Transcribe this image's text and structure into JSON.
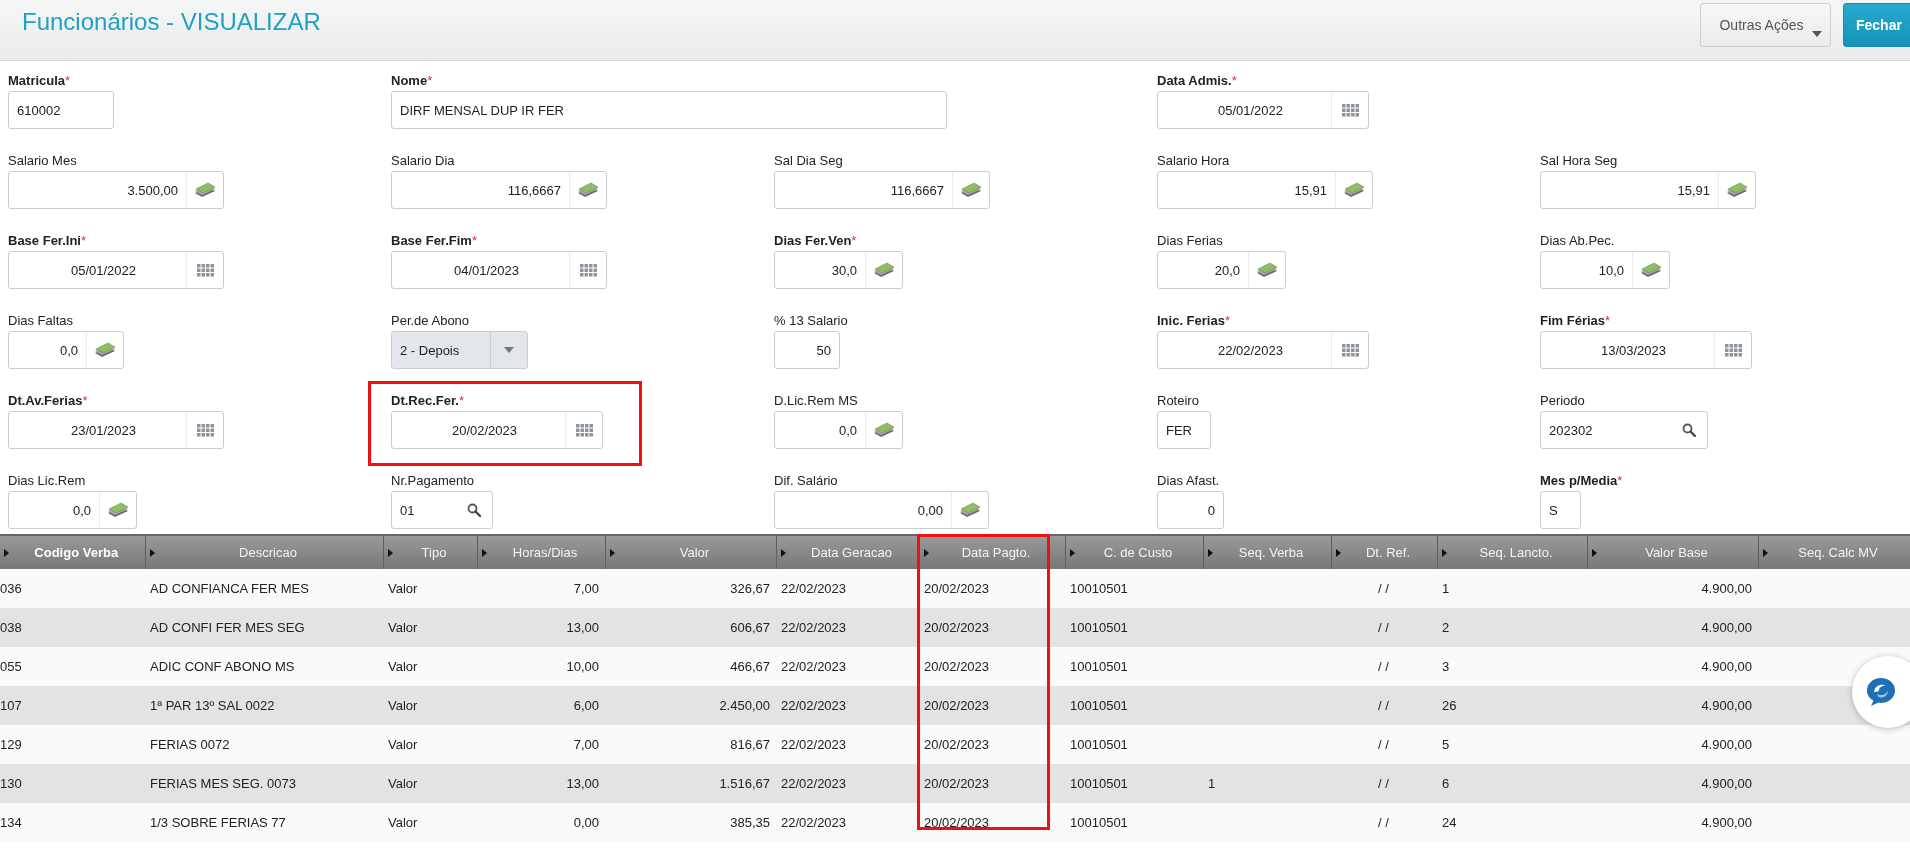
{
  "header": {
    "title": "Funcionários - VISUALIZAR",
    "buttons": [
      {
        "label": "Outras Ações",
        "kind": "menu"
      },
      {
        "label": "Fechar",
        "kind": "primary"
      }
    ]
  },
  "form": {
    "rows": [
      [
        {
          "label": "Matricula",
          "required_mark": "*",
          "kind": "text",
          "value": "610002",
          "highlighted": false
        },
        {
          "label": "Nome",
          "required_mark": "*",
          "kind": "text",
          "value": "DIRF MENSAL DUP IR FER",
          "highlighted": false
        },
        "",
        {
          "label": "Data Admis.",
          "required_mark": "*",
          "kind": "date",
          "value": "05/01/2022",
          "highlighted": false
        }
      ],
      [
        {
          "label": "Salario Mes",
          "kind": "money",
          "value": "3.500,00",
          "highlighted": false
        },
        {
          "label": "Salario Dia",
          "kind": "money",
          "value": "116,6667",
          "highlighted": false
        },
        {
          "label": "Sal Dia Seg",
          "kind": "money",
          "value": "116,6667",
          "highlighted": false
        },
        {
          "label": "Salario Hora",
          "kind": "money",
          "value": "15,91",
          "highlighted": false
        },
        {
          "label": "Sal Hora Seg",
          "kind": "money",
          "value": "15,91",
          "highlighted": false
        }
      ],
      [
        {
          "label": "Base Fer.Ini",
          "required_mark": "*",
          "kind": "date",
          "value": "05/01/2022",
          "highlighted": false
        },
        {
          "label": "Base Fer.Fim",
          "required_mark": "*",
          "kind": "date",
          "value": "04/01/2023",
          "highlighted": false
        },
        {
          "label": "Dias Fer.Ven",
          "required_mark": "*",
          "kind": "money",
          "value": "30,0",
          "highlighted": false
        },
        {
          "label": "Dias Ferias",
          "kind": "money",
          "value": "20,0",
          "highlighted": false
        },
        {
          "label": "Dias Ab.Pec.",
          "kind": "money",
          "value": "10,0",
          "highlighted": false
        }
      ],
      [
        {
          "label": "Dias Faltas",
          "kind": "money",
          "value": "0,0",
          "highlighted": false
        },
        {
          "label": "Per.de Abono",
          "kind": "select",
          "value": "2 - Depois",
          "highlighted": false
        },
        {
          "label": "% 13 Salario",
          "kind": "number",
          "value": "50",
          "highlighted": false
        },
        {
          "label": "Inic. Ferias",
          "required_mark": "*",
          "kind": "date",
          "value": "22/02/2023",
          "highlighted": false
        },
        {
          "label": "Fim Férias",
          "required_mark": "*",
          "kind": "date",
          "value": "13/03/2023",
          "highlighted": false
        }
      ],
      [
        {
          "label": "Dt.Av.Ferias",
          "required_mark": "*",
          "kind": "date",
          "value": "23/01/2023",
          "highlighted": false
        },
        {
          "label": "Dt.Rec.Fer.",
          "required_mark": "*",
          "kind": "date",
          "value": "20/02/2023",
          "highlighted": true
        },
        {
          "label": "D.Lic.Rem MS",
          "kind": "money",
          "value": "0,0",
          "highlighted": false
        },
        {
          "label": "Roteiro",
          "kind": "text",
          "value": "FER",
          "highlighted": false
        },
        {
          "label": "Periodo",
          "kind": "search",
          "value": "202302",
          "highlighted": false
        }
      ],
      [
        {
          "label": "Dias Lic.Rem",
          "kind": "money",
          "value": "0,0",
          "highlighted": false
        },
        {
          "label": "Nr.Pagamento",
          "kind": "search",
          "value": "01",
          "highlighted": false
        },
        {
          "label": "Dif. Salário",
          "kind": "money",
          "value": "0,00",
          "highlighted": false
        },
        {
          "label": "Dias Afast.",
          "kind": "number",
          "value": "0",
          "highlighted": false
        },
        {
          "label": "Mes p/Media",
          "required_mark": "*",
          "kind": "text",
          "value": "S",
          "highlighted": false
        }
      ]
    ]
  },
  "table": {
    "columns": [
      {
        "label": "Codigo Verba",
        "active": true,
        "highlighted": false
      },
      {
        "label": "Descricao",
        "active": false,
        "highlighted": false
      },
      {
        "label": "Tipo",
        "active": false,
        "highlighted": false
      },
      {
        "label": "Horas/Dias",
        "active": false,
        "highlighted": false
      },
      {
        "label": "Valor",
        "active": false,
        "highlighted": false
      },
      {
        "label": "Data Geracao",
        "active": false,
        "highlighted": false
      },
      {
        "label": "Data Pagto.",
        "active": false,
        "highlighted": true
      },
      {
        "label": "C. de Custo",
        "active": false,
        "highlighted": false
      },
      {
        "label": "Seq. Verba",
        "active": false,
        "highlighted": false
      },
      {
        "label": "Dt. Ref.",
        "active": false,
        "highlighted": false
      },
      {
        "label": "Seq. Lancto.",
        "active": false,
        "highlighted": false
      },
      {
        "label": "Valor Base",
        "active": false,
        "highlighted": false
      },
      {
        "label": "Seq. Calc MV",
        "active": false,
        "highlighted": false
      }
    ],
    "rows": [
      [
        "036",
        "AD CONFIANCA FER MES",
        "Valor",
        "7,00",
        "326,67",
        "22/02/2023",
        "20/02/2023",
        "10010501",
        null,
        "/ /",
        "1",
        "4.900,00",
        null
      ],
      [
        "038",
        "AD CONFI FER MES SEG",
        "Valor",
        "13,00",
        "606,67",
        "22/02/2023",
        "20/02/2023",
        "10010501",
        null,
        "/ /",
        "2",
        "4.900,00",
        null
      ],
      [
        "055",
        "ADIC CONF ABONO MS",
        "Valor",
        "10,00",
        "466,67",
        "22/02/2023",
        "20/02/2023",
        "10010501",
        null,
        "/ /",
        "3",
        "4.900,00",
        null
      ],
      [
        "107",
        "1ª PAR 13º SAL 0022",
        "Valor",
        "6,00",
        "2.450,00",
        "22/02/2023",
        "20/02/2023",
        "10010501",
        null,
        "/ /",
        "26",
        "4.900,00",
        null
      ],
      [
        "129",
        "FERIAS 0072",
        "Valor",
        "7,00",
        "816,67",
        "22/02/2023",
        "20/02/2023",
        "10010501",
        null,
        "/ /",
        "5",
        "4.900,00",
        null
      ],
      [
        "130",
        "FERIAS MES SEG. 0073",
        "Valor",
        "13,00",
        "1.516,67",
        "22/02/2023",
        "20/02/2023",
        "10010501",
        "1",
        "/ /",
        "6",
        "4.900,00",
        null
      ],
      [
        "134",
        "1/3 SOBRE FERIAS 77",
        "Valor",
        "0,00",
        "385,35",
        "22/02/2023",
        "20/02/2023",
        "10010501",
        null,
        "/ /",
        "24",
        "4.900,00",
        null
      ]
    ]
  }
}
